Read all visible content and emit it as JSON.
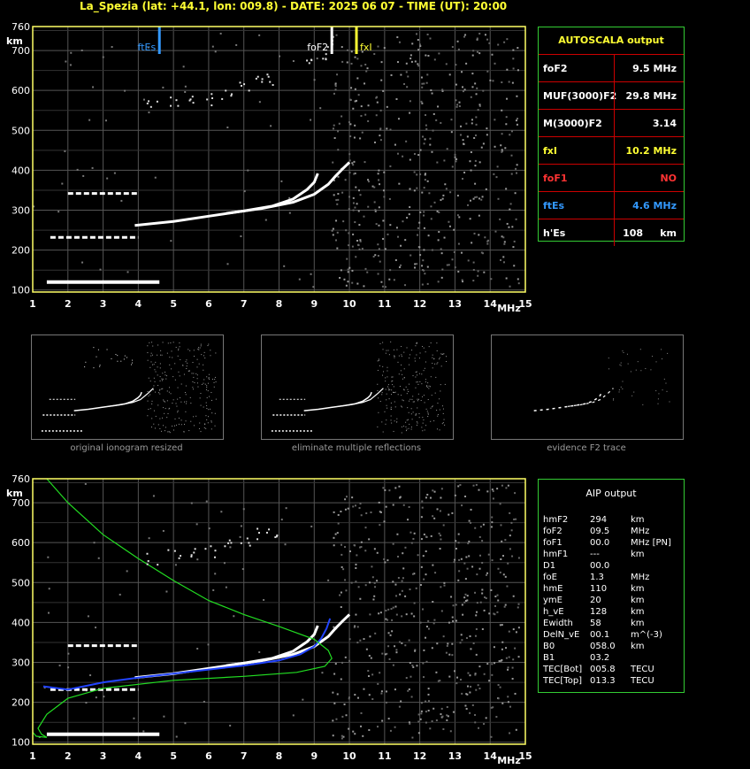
{
  "header": {
    "title": "La_Spezia (lat: +44.1, lon: 009.8) - DATE: 2025 06 07 - TIME (UT): 20:00"
  },
  "colors": {
    "axis": "#ffff66",
    "grid": "#555555",
    "frame": "#33cc33",
    "fte": "#3399ff",
    "foF1": "#ff3333",
    "blue_trace": "#2244ff",
    "profile": "#22dd22"
  },
  "chart_data": [
    {
      "type": "scatter",
      "title": "",
      "xlabel": "MHz",
      "ylabel": "km",
      "xlim": [
        1,
        15
      ],
      "ylim": [
        95,
        760
      ],
      "x_ticks": [
        1,
        2,
        3,
        4,
        5,
        6,
        7,
        8,
        9,
        10,
        11,
        12,
        13,
        14,
        15
      ],
      "y_ticks": [
        100,
        200,
        300,
        400,
        500,
        600,
        700,
        760
      ],
      "grid": true,
      "markers": [
        {
          "name": "ftEs",
          "freq": 4.6,
          "color": "#3399ff"
        },
        {
          "name": "foF2",
          "freq": 9.5,
          "color": "#ffffff"
        },
        {
          "name": "fxI",
          "freq": 10.2,
          "color": "#ffff33"
        }
      ],
      "traces": [
        {
          "name": "Es",
          "type": "segment",
          "x": [
            1.4,
            4.6
          ],
          "y": [
            120,
            120
          ]
        },
        {
          "name": "Es multiple 1",
          "type": "dashed",
          "x": [
            1.5,
            4.0
          ],
          "y": [
            232,
            232
          ]
        },
        {
          "name": "Es multiple 2",
          "type": "dashed",
          "x": [
            2.0,
            4.0
          ],
          "y": [
            342,
            342
          ]
        },
        {
          "name": "O trace",
          "type": "curve",
          "points": [
            [
              3.9,
              262
            ],
            [
              5.0,
              272
            ],
            [
              6.0,
              285
            ],
            [
              7.0,
              298
            ],
            [
              7.8,
              310
            ],
            [
              8.4,
              328
            ],
            [
              8.8,
              352
            ],
            [
              9.0,
              370
            ],
            [
              9.1,
              392
            ]
          ]
        },
        {
          "name": "X trace",
          "type": "curve",
          "points": [
            [
              6.5,
              292
            ],
            [
              7.5,
              304
            ],
            [
              8.4,
              320
            ],
            [
              9.0,
              340
            ],
            [
              9.4,
              365
            ],
            [
              9.6,
              385
            ],
            [
              9.8,
              403
            ],
            [
              10.0,
              420
            ]
          ]
        },
        {
          "name": "F2 multiple",
          "type": "scatter",
          "points": [
            [
              4.4,
              560
            ],
            [
              5.0,
              570
            ],
            [
              5.5,
              575
            ],
            [
              6.0,
              580
            ],
            [
              6.5,
              595
            ],
            [
              7.0,
              608
            ],
            [
              7.5,
              622
            ],
            [
              7.8,
              630
            ],
            [
              8.9,
              680
            ],
            [
              9.2,
              690
            ],
            [
              9.4,
              712
            ]
          ]
        }
      ]
    },
    {
      "type": "scatter",
      "title": "",
      "xlabel": "MHz",
      "ylabel": "km",
      "xlim": [
        1,
        15
      ],
      "ylim": [
        95,
        760
      ],
      "x_ticks": [
        1,
        2,
        3,
        4,
        5,
        6,
        7,
        8,
        9,
        10,
        11,
        12,
        13,
        14,
        15
      ],
      "y_ticks": [
        100,
        200,
        300,
        400,
        500,
        600,
        700,
        760
      ],
      "grid": true,
      "traces": [
        {
          "name": "Es",
          "type": "segment",
          "x": [
            1.4,
            4.6
          ],
          "y": [
            120,
            120
          ]
        },
        {
          "name": "Es multiple 1",
          "type": "dashed",
          "x": [
            1.5,
            4.0
          ],
          "y": [
            232,
            232
          ]
        },
        {
          "name": "Es multiple 2",
          "type": "dashed",
          "x": [
            2.0,
            4.0
          ],
          "y": [
            342,
            342
          ]
        },
        {
          "name": "O trace",
          "type": "curve",
          "points": [
            [
              3.9,
              262
            ],
            [
              5.0,
              272
            ],
            [
              6.0,
              285
            ],
            [
              7.0,
              298
            ],
            [
              7.8,
              310
            ],
            [
              8.4,
              328
            ],
            [
              8.8,
              352
            ],
            [
              9.0,
              370
            ],
            [
              9.1,
              392
            ]
          ]
        },
        {
          "name": "X trace",
          "type": "curve",
          "points": [
            [
              6.5,
              292
            ],
            [
              7.5,
              304
            ],
            [
              8.4,
              320
            ],
            [
              9.0,
              340
            ],
            [
              9.4,
              365
            ],
            [
              9.6,
              385
            ],
            [
              9.8,
              403
            ],
            [
              10.0,
              420
            ]
          ]
        },
        {
          "name": "blue AIP trace",
          "type": "curve",
          "color": "#2244ff",
          "points": [
            [
              1.3,
              240
            ],
            [
              2.0,
              232
            ],
            [
              3.0,
              250
            ],
            [
              4.0,
              262
            ],
            [
              5.0,
              272
            ],
            [
              6.0,
              282
            ],
            [
              7.0,
              292
            ],
            [
              8.0,
              305
            ],
            [
              8.6,
              320
            ],
            [
              9.0,
              340
            ],
            [
              9.2,
              360
            ],
            [
              9.35,
              385
            ],
            [
              9.45,
              410
            ]
          ]
        },
        {
          "name": "electron density profile",
          "type": "curve",
          "color": "#22dd22",
          "points": [
            [
              1.4,
              760
            ],
            [
              2.0,
              700
            ],
            [
              3.0,
              620
            ],
            [
              4.0,
              560
            ],
            [
              5.0,
              505
            ],
            [
              6.0,
              455
            ],
            [
              7.0,
              420
            ],
            [
              8.0,
              390
            ],
            [
              9.0,
              358
            ],
            [
              9.4,
              330
            ],
            [
              9.5,
              310
            ],
            [
              9.3,
              290
            ],
            [
              8.5,
              275
            ],
            [
              7.0,
              265
            ],
            [
              5.0,
              255
            ],
            [
              3.0,
              235
            ],
            [
              2.0,
              210
            ],
            [
              1.4,
              170
            ],
            [
              1.15,
              135
            ],
            [
              1.25,
              120
            ],
            [
              1.4,
              112
            ],
            [
              1.1,
              115
            ],
            [
              1.0,
              125
            ]
          ]
        },
        {
          "name": "F2 multiple",
          "type": "scatter",
          "points": [
            [
              4.4,
              560
            ],
            [
              5.0,
              570
            ],
            [
              5.5,
              575
            ],
            [
              6.0,
              580
            ],
            [
              6.5,
              595
            ],
            [
              7.0,
              608
            ],
            [
              7.5,
              622
            ],
            [
              7.8,
              630
            ]
          ]
        }
      ]
    }
  ],
  "autoscala": {
    "title": "AUTOSCALA output",
    "rows": [
      {
        "label": "foF2",
        "value": "9.5 MHz",
        "color": "#ffffff",
        "vcolor": "#ffffff"
      },
      {
        "label": "MUF(3000)F2",
        "value": "29.8 MHz",
        "color": "#ffffff",
        "vcolor": "#ffffff"
      },
      {
        "label": "M(3000)F2",
        "value": "3.14",
        "color": "#ffffff",
        "vcolor": "#ffffff"
      },
      {
        "label": "fxI",
        "value": "10.2 MHz",
        "color": "#ffff33",
        "vcolor": "#ffff33"
      },
      {
        "label": "foF1",
        "value": "NO",
        "color": "#ff3333",
        "vcolor": "#ff3333"
      },
      {
        "label": "ftEs",
        "value": "4.6 MHz",
        "color": "#3399ff",
        "vcolor": "#3399ff"
      },
      {
        "label": "h'Es",
        "value": "108     km",
        "color": "#ffffff",
        "vcolor": "#ffffff"
      }
    ]
  },
  "thumbnails": [
    {
      "caption": "original ionogram resized"
    },
    {
      "caption": "eliminate multiple reflections"
    },
    {
      "caption": "evidence F2 trace"
    }
  ],
  "aip": {
    "title": "AIP output",
    "rows": [
      {
        "name": "hmF2",
        "value": "294",
        "unit": "km"
      },
      {
        "name": "foF2",
        "value": "09.5",
        "unit": "MHz"
      },
      {
        "name": "foF1",
        "value": "00.0",
        "unit": "MHz   [PN]"
      },
      {
        "name": "hmF1",
        "value": "---",
        "unit": "km"
      },
      {
        "name": "D1",
        "value": "00.0",
        "unit": ""
      },
      {
        "name": "foE",
        "value": "1.3",
        "unit": "MHz"
      },
      {
        "name": "hmE",
        "value": "110",
        "unit": "km"
      },
      {
        "name": "ymE",
        "value": "20",
        "unit": "km"
      },
      {
        "name": "h_vE",
        "value": "128",
        "unit": "km"
      },
      {
        "name": "Ewidth",
        "value": "58",
        "unit": "km"
      },
      {
        "name": "DelN_vE",
        "value": "00.1",
        "unit": "m^(-3)"
      },
      {
        "name": "B0",
        "value": "058.0",
        "unit": "km"
      },
      {
        "name": "B1",
        "value": "03.2",
        "unit": ""
      },
      {
        "name": "TEC[Bot]",
        "value": "005.8",
        "unit": "TECU"
      },
      {
        "name": "TEC[Top]",
        "value": "013.3",
        "unit": "TECU"
      }
    ]
  }
}
